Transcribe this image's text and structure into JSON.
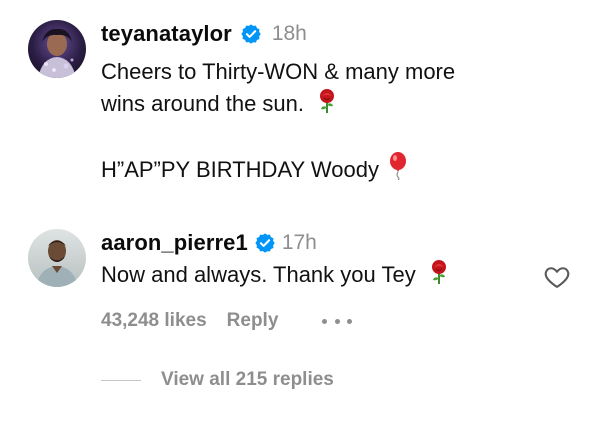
{
  "comment1": {
    "username": "teyanataylor",
    "time": "18h",
    "line1": "Cheers to Thirty-WON & many more",
    "line2": "wins around the sun.",
    "line3": "H”AP”PY BIRTHDAY Woody",
    "emoji_rose": "rose",
    "emoji_balloon": "balloon"
  },
  "comment2": {
    "username": "aaron_pierre1",
    "time": "17h",
    "text": "Now and always. Thank you Tey",
    "likes": "43,248 likes",
    "reply_label": "Reply",
    "emoji_rose": "rose",
    "liked": false
  },
  "view_replies": "View all 215 replies",
  "colors": {
    "verified_blue": "#0095F6",
    "muted_gray": "#8E8E8E",
    "text": "#0F0F0F"
  }
}
